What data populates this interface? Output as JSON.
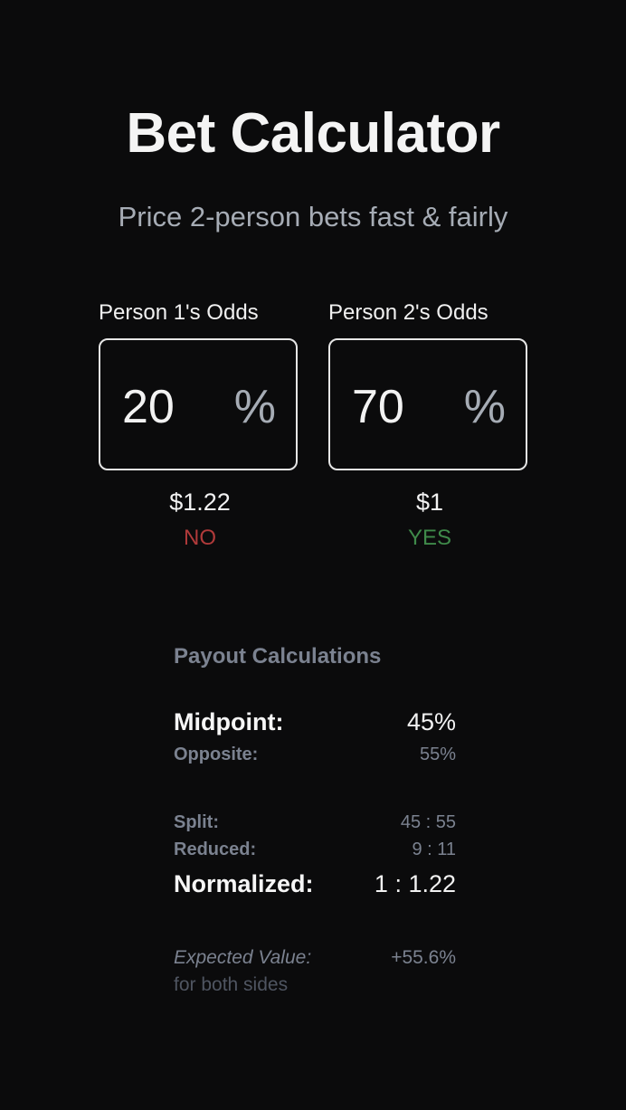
{
  "header": {
    "title": "Bet Calculator",
    "subtitle": "Price 2-person bets fast & fairly"
  },
  "person1": {
    "label": "Person 1's Odds",
    "odds_value": "20",
    "percent_symbol": "%",
    "payout": "$1.22",
    "side": "NO"
  },
  "person2": {
    "label": "Person 2's Odds",
    "odds_value": "70",
    "percent_symbol": "%",
    "payout": "$1",
    "side": "YES"
  },
  "calculations": {
    "title": "Payout Calculations",
    "midpoint_label": "Midpoint:",
    "midpoint_value": "45%",
    "opposite_label": "Opposite:",
    "opposite_value": "55%",
    "split_label": "Split:",
    "split_value": "45 : 55",
    "reduced_label": "Reduced:",
    "reduced_value": "9 : 11",
    "normalized_label": "Normalized:",
    "normalized_value": "1 : 1.22",
    "ev_label": "Expected Value:",
    "ev_value": "+55.6%",
    "ev_sub": "for both sides"
  },
  "colors": {
    "background": "#0b0b0c",
    "muted": "#7b8290",
    "no": "#b03a3a",
    "yes": "#3f8a4a"
  }
}
